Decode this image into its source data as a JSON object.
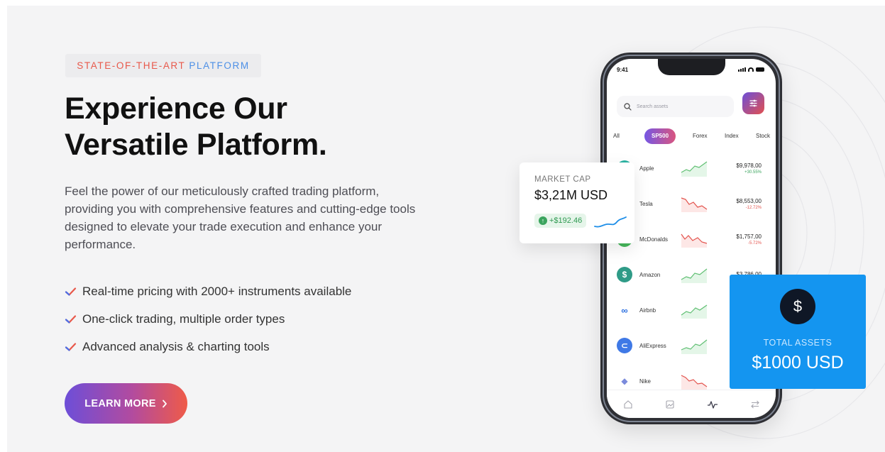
{
  "hero": {
    "eyebrow_part1": "STATE-OF-THE-ART",
    "eyebrow_part2": "PLATFORM",
    "headline_line1": "Experience Our",
    "headline_line2": "Versatile Platform.",
    "description": "Feel the power of our meticulously crafted trading platform, providing you with comprehensive features and cutting-edge tools designed to elevate your trade execution and enhance your performance.",
    "features": [
      "Real-time pricing with 2000+ instruments available",
      "One-click trading, multiple order types",
      "Advanced analysis & charting tools"
    ],
    "cta_label": "LEARN MORE",
    "cta_icon": "chevron-right-icon"
  },
  "colors": {
    "eyebrow_red": "#e8584a",
    "eyebrow_blue": "#4c8fe6",
    "check": "#e8584a",
    "gain": "#3aa45d",
    "loss": "#e3534d",
    "assets_card": "#1495f0"
  },
  "phone": {
    "time": "9:41",
    "search_placeholder": "Search assets",
    "filter_icon": "sliders-icon",
    "tabs": [
      "All",
      "SP500",
      "Forex",
      "Index",
      "Stock"
    ],
    "active_tab": "SP500",
    "assets": [
      {
        "name": "Apple",
        "price": "$9,978,00",
        "change": "+30.55%",
        "trend": "up",
        "logo_color": "#2bb3a3",
        "logo_icon": "apple-icon"
      },
      {
        "name": "Tesla",
        "price": "$8,553,00",
        "change": "-12.72%",
        "trend": "down",
        "logo_color": "#2a2a2e",
        "logo_icon": "tesla-icon"
      },
      {
        "name": "McDonalds",
        "price": "$1,757,00",
        "change": "-5.72%",
        "trend": "down",
        "logo_color": "#46b85c",
        "logo_icon": "mcdonalds-icon"
      },
      {
        "name": "Amazon",
        "price": "$3,786,00",
        "change": "",
        "trend": "up",
        "logo_color": "#2f9b87",
        "logo_icon": "amazon-icon"
      },
      {
        "name": "Airbnb",
        "price": "$",
        "change": "",
        "trend": "up",
        "logo_color": "#ffffff",
        "logo_icon": "meta-icon"
      },
      {
        "name": "AliExpress",
        "price": "$",
        "change": "",
        "trend": "up",
        "logo_color": "#3f79e6",
        "logo_icon": "aliexpress-icon"
      },
      {
        "name": "Nike",
        "price": "$",
        "change": "",
        "trend": "down",
        "logo_color": "#ffffff",
        "logo_icon": "ethereum-icon"
      }
    ],
    "nav_icons": [
      "home-icon",
      "gallery-icon",
      "activity-icon",
      "transfer-icon"
    ]
  },
  "market_cap_card": {
    "label": "MARKET CAP",
    "value": "$3,21M USD",
    "change": "+$192.46"
  },
  "total_assets_card": {
    "label": "TOTAL ASSETS",
    "value": "$1000 USD",
    "icon_glyph": "$"
  }
}
